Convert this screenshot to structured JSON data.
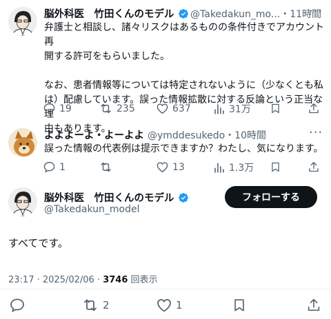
{
  "tweet1": {
    "display_name": "脳外科医　竹田くんのモデル",
    "handle": "@Takedakun_mo...",
    "time": "・11時間",
    "text_line1": "弁護士と相談し、諸々リスクはあるものの条件付きでアカウント再",
    "text_line2": "開する許可をもらいました。",
    "text_line3": "なお、患者情報等については特定されないように（少なくとも私",
    "text_line4": "は）配慮しています。誤った情報拡散に対する反論という正当な理",
    "text_line5": "由もあります。",
    "replies": "19",
    "retweets": "235",
    "likes": "637",
    "views": "31万"
  },
  "tweet2": {
    "display_name": "よよよーよ・よーよよ",
    "handle": "@ymddesukedo",
    "time": "・10時間",
    "text": "誤った情報の代表例は提示できますか？わたし、気になります。",
    "replies": "1",
    "likes": "13",
    "views": "1.3万"
  },
  "main": {
    "display_name": "脳外科医　竹田くんのモデル",
    "handle": "@Takedakun_model",
    "follow_label": "フォローする",
    "text": "すべてです。",
    "timestamp": "23:17 · 2025/02/06 · ",
    "views_count": "3746",
    "views_label": " 回表示",
    "retweets": "2",
    "likes": "1"
  },
  "colors": {
    "text": "#0f1419",
    "secondary": "#536471",
    "verified": "#1d9bf0",
    "divider": "#eff3f4"
  },
  "icons": [
    "reply-icon",
    "retweet-icon",
    "like-icon",
    "views-icon",
    "bookmark-icon",
    "share-icon",
    "verified-badge-icon",
    "more-icon"
  ]
}
